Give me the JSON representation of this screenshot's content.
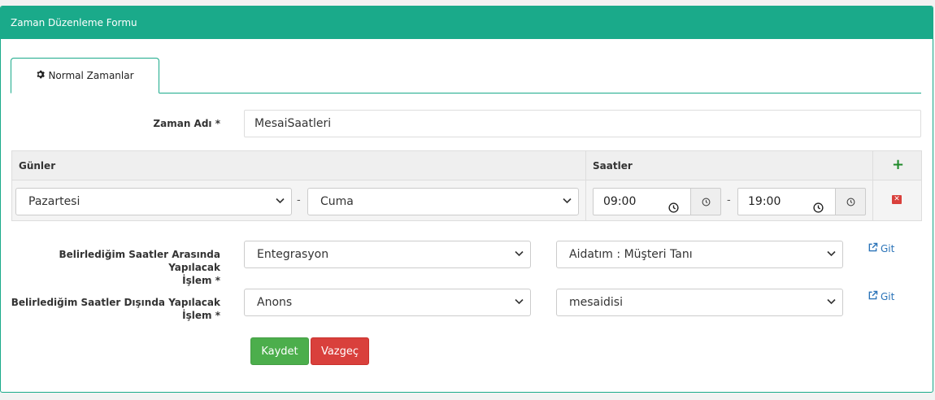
{
  "panel": {
    "title": "Zaman Düzenleme Formu"
  },
  "tabs": [
    {
      "label": "Normal Zamanlar",
      "icon": "gear-icon"
    }
  ],
  "form": {
    "name_label": "Zaman Adı *",
    "name_value": "MesaiSaatleri",
    "table": {
      "col_days": "Günler",
      "col_hours": "Saatler",
      "add_icon": "plus-icon",
      "row": {
        "day_from": "Pazartesi",
        "day_to": "Cuma",
        "time_from": "09:00",
        "time_to": "19:00",
        "delete_icon": "remove-icon"
      }
    },
    "inside": {
      "label_line1": "Belirlediğim Saatler Arasında Yapılacak",
      "label_line2": "İşlem *",
      "select1": "Entegrasyon",
      "select2": "Aidatım : Müşteri Tanı",
      "link": "Git"
    },
    "outside": {
      "label_line1": "Belirlediğim Saatler Dışında Yapılacak",
      "label_line2": "İşlem *",
      "select1": "Anons",
      "select2": "mesaidisi",
      "link": "Git"
    },
    "save_label": "Kaydet",
    "cancel_label": "Vazgeç"
  },
  "colors": {
    "header": "#1aaa8a",
    "save": "#4cae4c",
    "cancel": "#d9403c",
    "link": "#2a73b8",
    "add": "#1f8a2a"
  }
}
